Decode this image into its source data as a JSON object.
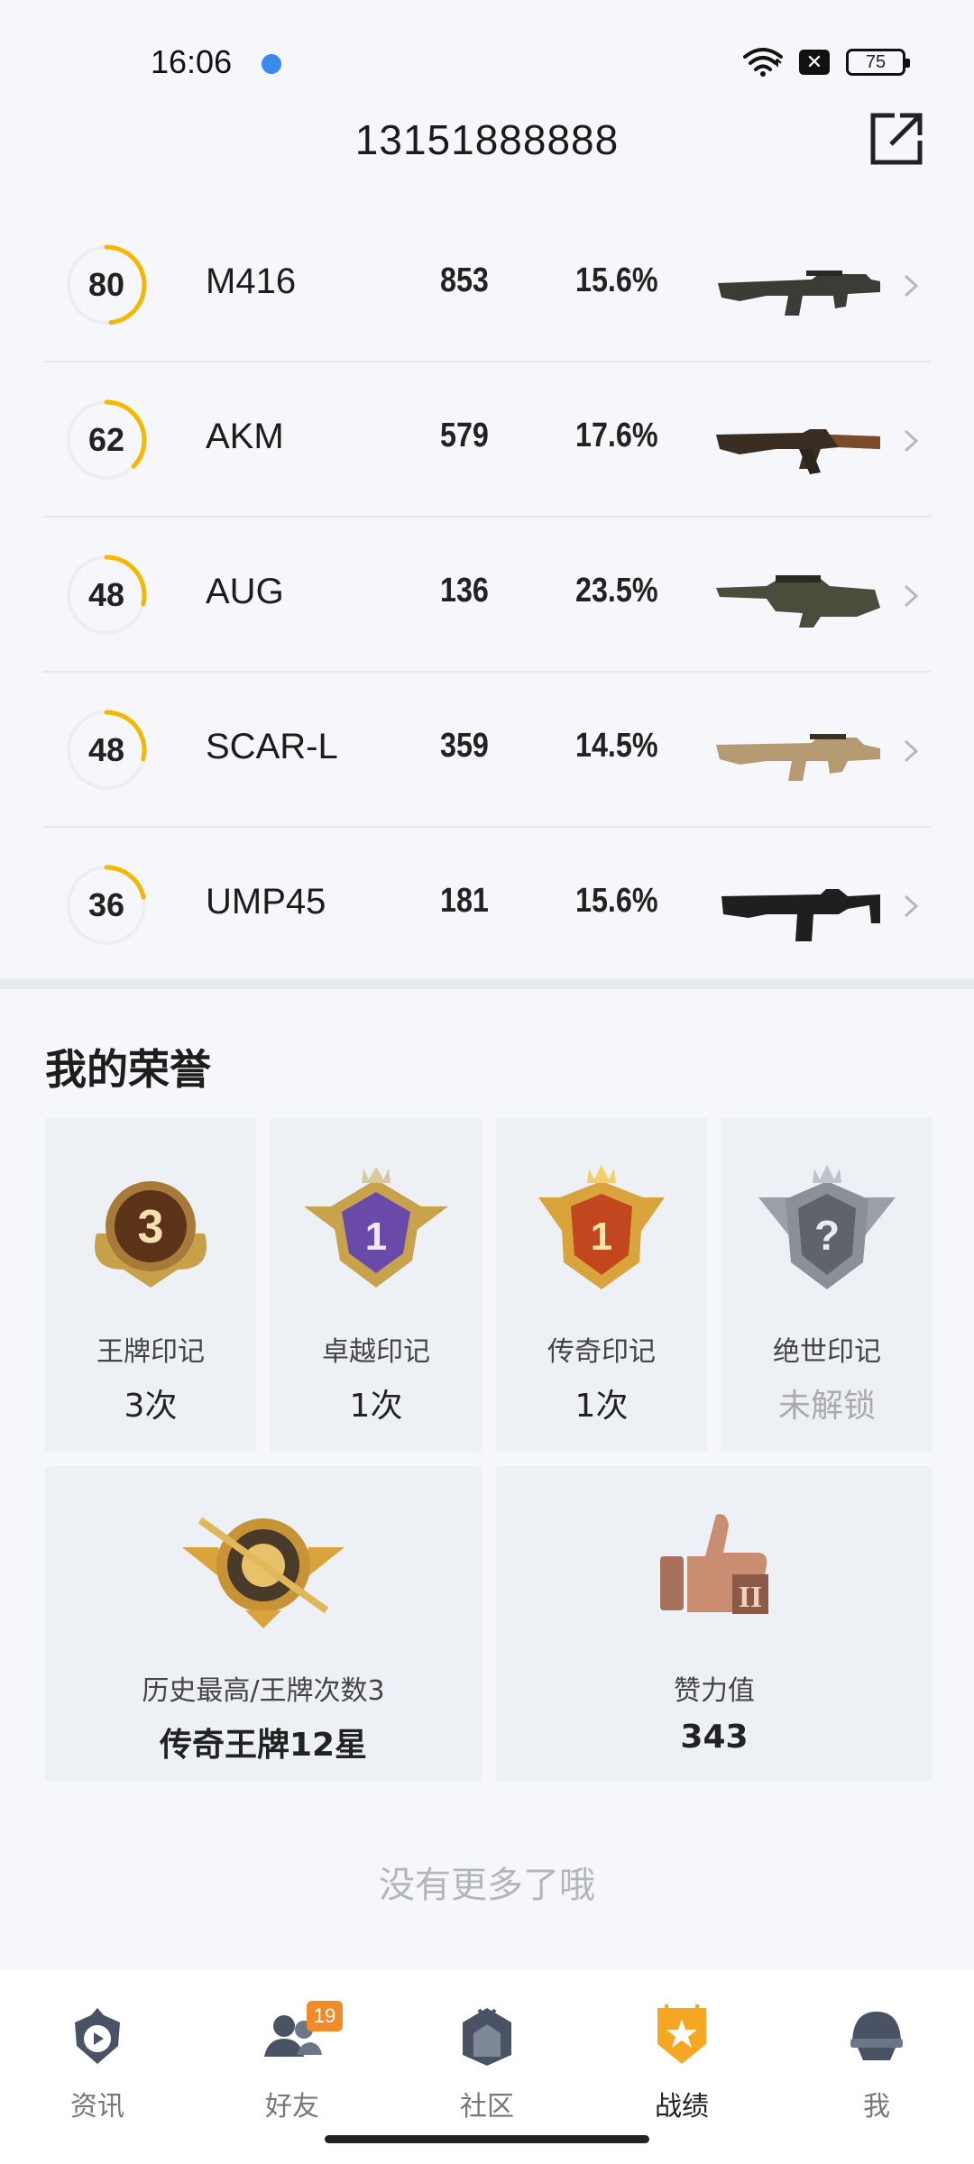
{
  "status_bar": {
    "time": "16:06",
    "battery": "75"
  },
  "header": {
    "title": "13151888888",
    "share_icon": "share-icon"
  },
  "weapons": [
    {
      "score": "80",
      "score_value": 80,
      "name": "M416",
      "kills": "853",
      "rate": "15.6%",
      "icon": "m416-rifle"
    },
    {
      "score": "62",
      "score_value": 62,
      "name": "AKM",
      "kills": "579",
      "rate": "17.6%",
      "icon": "akm-rifle"
    },
    {
      "score": "48",
      "score_value": 48,
      "name": "AUG",
      "kills": "136",
      "rate": "23.5%",
      "icon": "aug-rifle"
    },
    {
      "score": "48",
      "score_value": 48,
      "name": "SCAR-L",
      "kills": "359",
      "rate": "14.5%",
      "icon": "scar-l-rifle"
    },
    {
      "score": "36",
      "score_value": 36,
      "name": "UMP45",
      "kills": "181",
      "rate": "15.6%",
      "icon": "ump45-smg"
    }
  ],
  "honors": {
    "title": "我的荣誉",
    "marks": [
      {
        "label": "王牌印记",
        "value": "3次",
        "icon": "ace-mark-badge",
        "locked": false
      },
      {
        "label": "卓越印记",
        "value": "1次",
        "icon": "excellence-mark-badge",
        "locked": false
      },
      {
        "label": "传奇印记",
        "value": "1次",
        "icon": "legend-mark-badge",
        "locked": false
      },
      {
        "label": "绝世印记",
        "value": "未解锁",
        "icon": "peerless-mark-badge",
        "locked": true
      }
    ],
    "highest": {
      "label": "历史最高/王牌次数3",
      "value": "传奇王牌12星",
      "icon": "highest-rank-badge"
    },
    "likes": {
      "label": "赞力值",
      "value": "343",
      "icon": "thumbs-up-badge"
    }
  },
  "footer_text": "没有更多了哦",
  "nav": [
    {
      "label": "资讯",
      "icon": "news-icon",
      "active": false
    },
    {
      "label": "好友",
      "icon": "friends-icon",
      "active": false,
      "badge": "19"
    },
    {
      "label": "社区",
      "icon": "community-icon",
      "active": false
    },
    {
      "label": "战绩",
      "icon": "record-icon",
      "active": true
    },
    {
      "label": "我",
      "icon": "profile-icon",
      "active": false
    }
  ],
  "colors": {
    "ring_accent": "#f5b800",
    "nav_active": "#f5a623",
    "badge": "#f08b2a"
  }
}
